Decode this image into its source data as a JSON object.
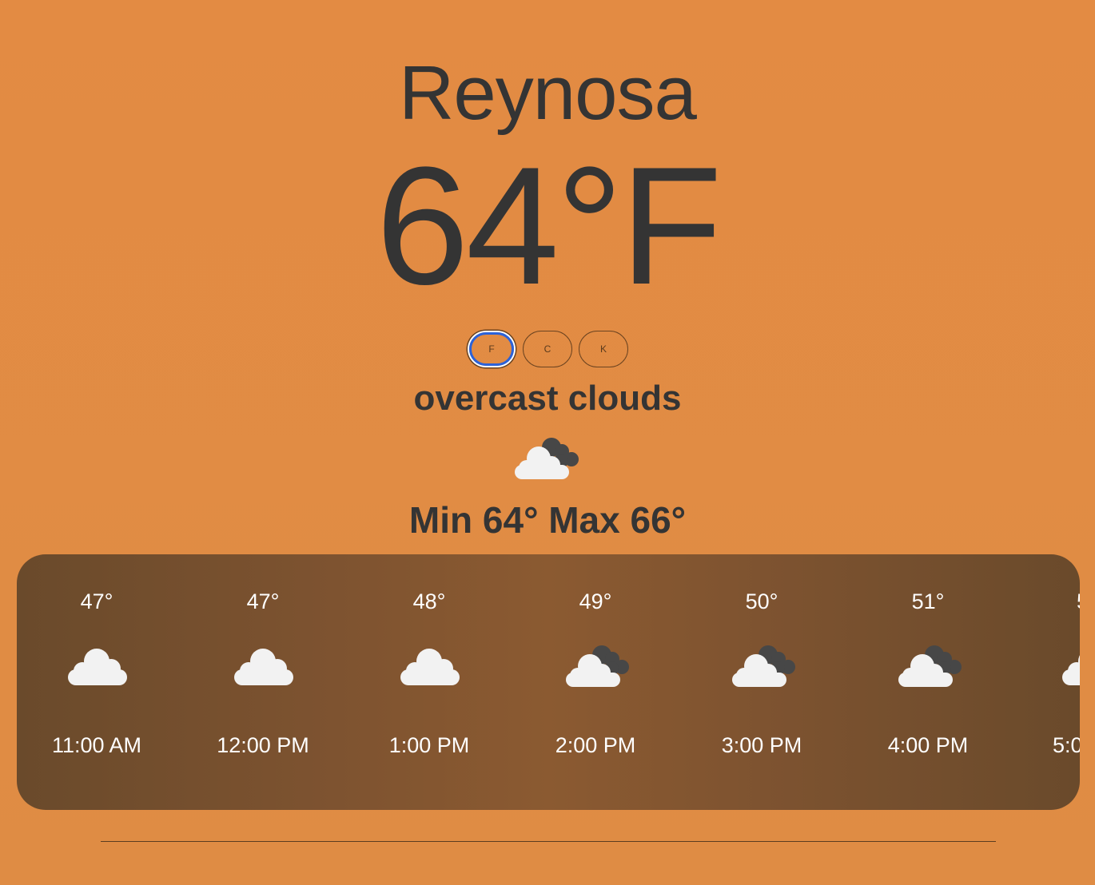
{
  "city": "Reynosa",
  "temperature": "64°F",
  "units": [
    {
      "label": "F",
      "selected": true
    },
    {
      "label": "C",
      "selected": false
    },
    {
      "label": "K",
      "selected": false
    }
  ],
  "description": "overcast clouds",
  "current_icon": "overcast-clouds-icon",
  "minmax": "Min 64° Max 66°",
  "hourly": [
    {
      "temp": "47°",
      "time": "11:00 AM",
      "icon": "cloud-icon"
    },
    {
      "temp": "47°",
      "time": "12:00 PM",
      "icon": "cloud-icon"
    },
    {
      "temp": "48°",
      "time": "1:00 PM",
      "icon": "cloud-icon"
    },
    {
      "temp": "49°",
      "time": "2:00 PM",
      "icon": "overcast-clouds-icon"
    },
    {
      "temp": "50°",
      "time": "3:00 PM",
      "icon": "overcast-clouds-icon"
    },
    {
      "temp": "51°",
      "time": "4:00 PM",
      "icon": "overcast-clouds-icon"
    },
    {
      "temp": "5",
      "time": "5:0",
      "icon": "cloud-icon"
    }
  ],
  "colors": {
    "background": "#e08c42",
    "text": "#343434",
    "forecast_panel": "#7e5330",
    "selected_outline": "#2b62d9"
  }
}
